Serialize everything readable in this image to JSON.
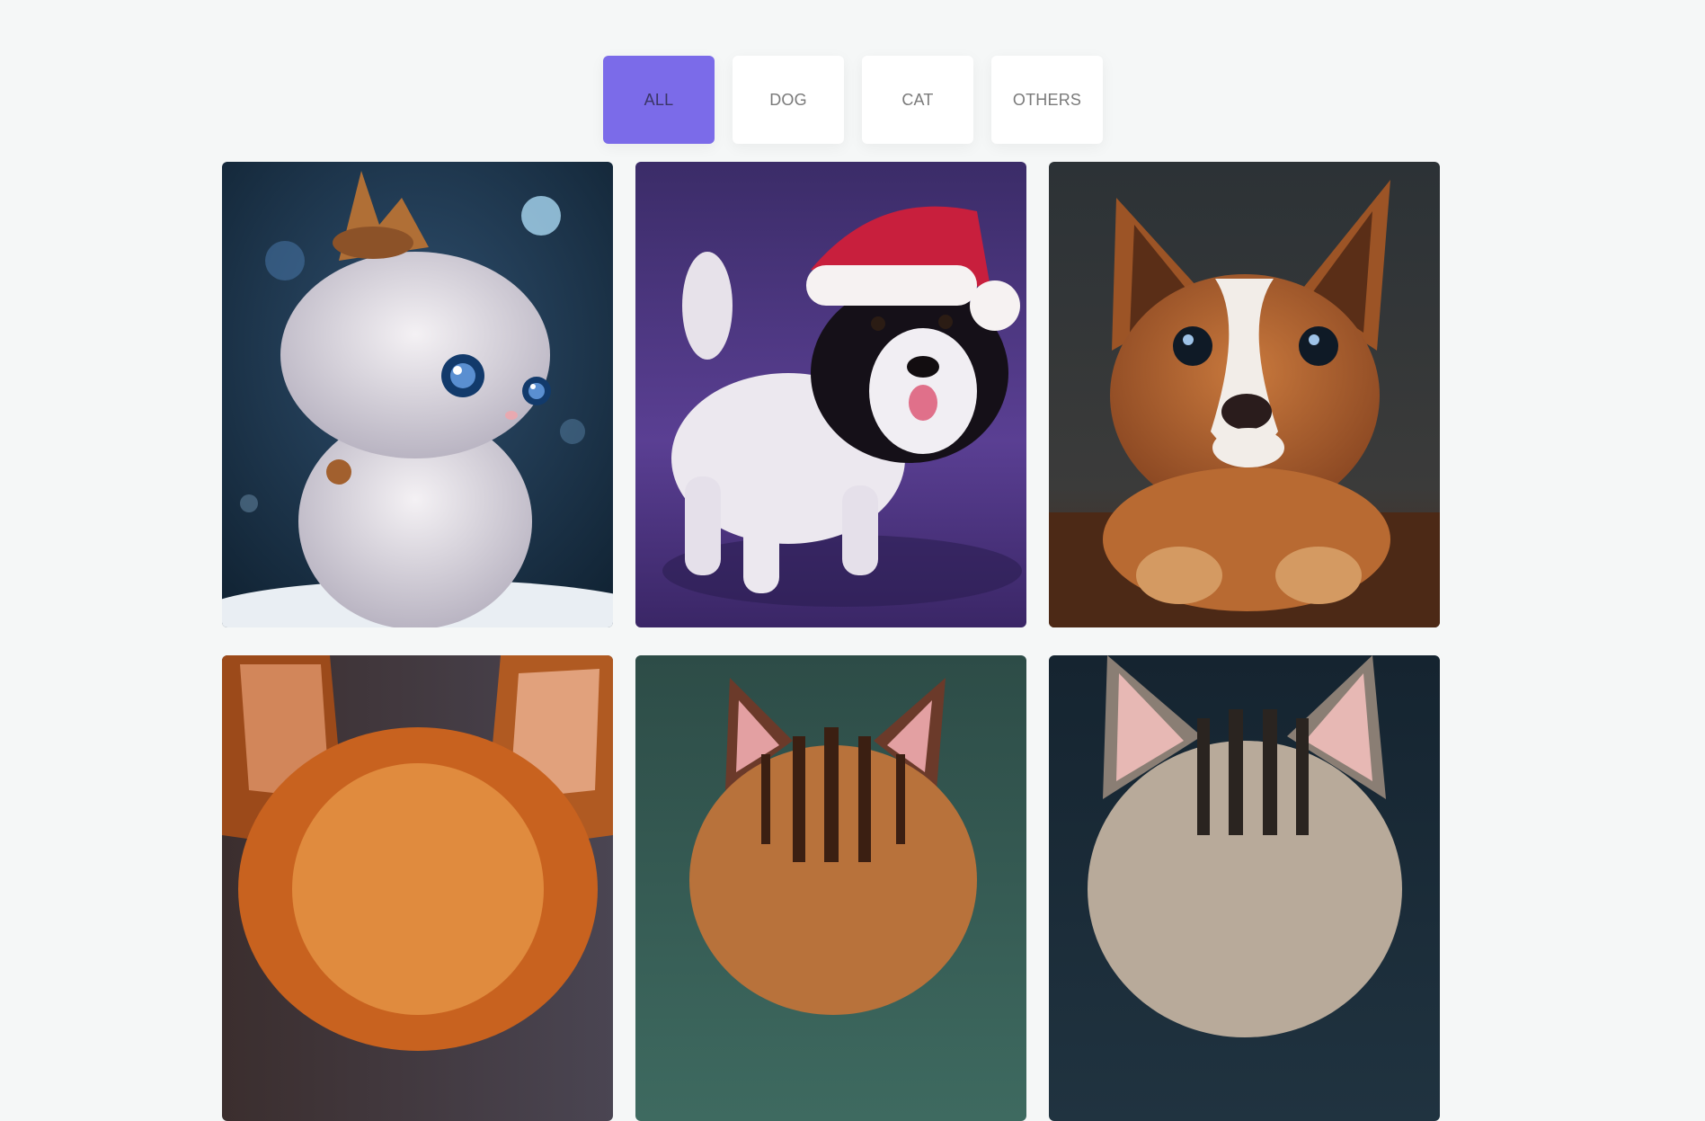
{
  "filters": [
    {
      "label": "ALL",
      "active": true
    },
    {
      "label": "DOG",
      "active": false
    },
    {
      "label": "CAT",
      "active": false
    },
    {
      "label": "OTHERS",
      "active": false
    }
  ],
  "gallery": {
    "items": [
      {
        "subject": "white fluffy kitten with party hat",
        "category": "CAT"
      },
      {
        "subject": "puppy with santa hat",
        "category": "DOG"
      },
      {
        "subject": "brown and white puppy",
        "category": "DOG"
      },
      {
        "subject": "orange kitten",
        "category": "CAT"
      },
      {
        "subject": "striped tabby kitten",
        "category": "CAT"
      },
      {
        "subject": "grey tabby kitten",
        "category": "CAT"
      }
    ]
  },
  "colors": {
    "accent": "#7b6be9",
    "page_background": "#f5f7f7",
    "button_background": "#ffffff",
    "button_text": "#7a7a7a"
  }
}
